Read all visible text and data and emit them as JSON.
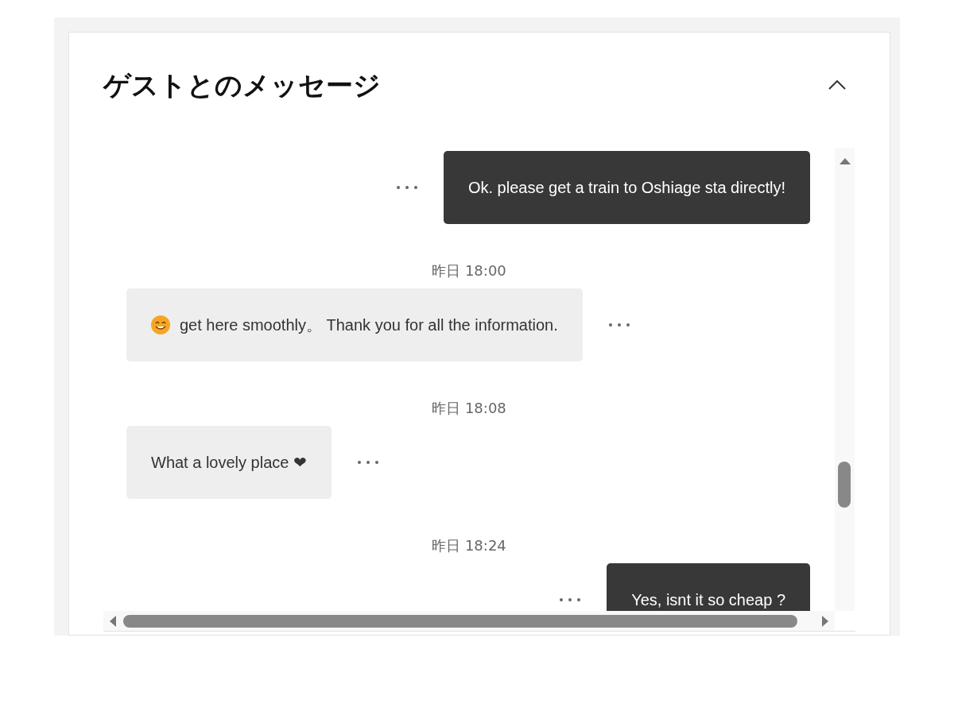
{
  "panel": {
    "title": "ゲストとのメッセージ",
    "expanded": true
  },
  "messages": [
    {
      "kind": "outgoing",
      "text": "Ok. please get a train to Oshiage sta directly!"
    },
    {
      "kind": "timestamp",
      "text": "昨日 18:00"
    },
    {
      "kind": "incoming",
      "with_emoji": true,
      "text": "get here smoothly。 Thank you for all the information."
    },
    {
      "kind": "timestamp",
      "text": "昨日 18:08"
    },
    {
      "kind": "incoming",
      "text": "What a lovely place ❤"
    },
    {
      "kind": "timestamp",
      "text": "昨日 18:24"
    },
    {
      "kind": "outgoing",
      "text": "Yes, isnt it so cheap ?"
    }
  ]
}
